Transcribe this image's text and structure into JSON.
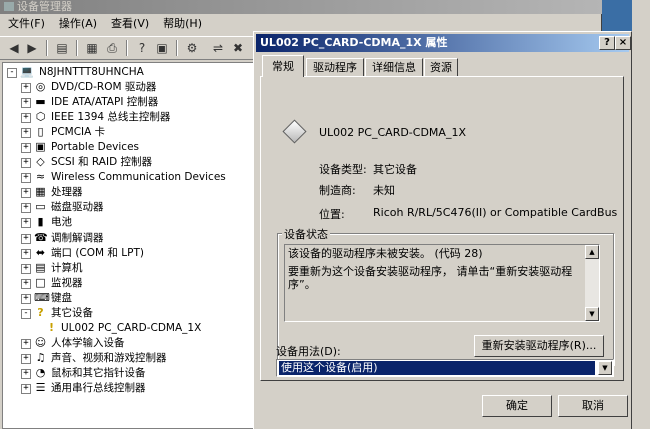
{
  "main_window": {
    "title": "设备管理器",
    "menu": [
      "文件(F)",
      "操作(A)",
      "查看(V)",
      "帮助(H)"
    ],
    "toolbar_icons": [
      "back-arrow-icon",
      "forward-arrow-icon",
      "tree-view-icon",
      "properties-icon",
      "print-icon",
      "help-icon",
      "refresh-icon",
      "scan-hardware-icon",
      "update-driver-icon",
      "uninstall-icon"
    ]
  },
  "tree": {
    "root": "N8JHNTTT8UHNCHA",
    "items": [
      {
        "label": "DVD/CD-ROM 驱动器",
        "icon": "cdrom-icon",
        "expander": "+"
      },
      {
        "label": "IDE ATA/ATAPI 控制器",
        "icon": "ide-icon",
        "expander": "+"
      },
      {
        "label": "IEEE 1394 总线主控制器",
        "icon": "ieee1394-icon",
        "expander": "+"
      },
      {
        "label": "PCMCIA 卡",
        "icon": "pcmcia-icon",
        "expander": "+"
      },
      {
        "label": "Portable Devices",
        "icon": "portable-device-icon",
        "expander": "+"
      },
      {
        "label": "SCSI 和 RAID 控制器",
        "icon": "scsi-icon",
        "expander": "+"
      },
      {
        "label": "Wireless Communication Devices",
        "icon": "wireless-icon",
        "expander": "+"
      },
      {
        "label": "处理器",
        "icon": "processor-icon",
        "expander": "+"
      },
      {
        "label": "磁盘驱动器",
        "icon": "disk-icon",
        "expander": "+"
      },
      {
        "label": "电池",
        "icon": "battery-icon",
        "expander": "+"
      },
      {
        "label": "调制解调器",
        "icon": "modem-icon",
        "expander": "+"
      },
      {
        "label": "端口 (COM 和 LPT)",
        "icon": "port-icon",
        "expander": "+"
      },
      {
        "label": "计算机",
        "icon": "computer-icon",
        "expander": "+"
      },
      {
        "label": "监视器",
        "icon": "monitor-icon",
        "expander": "+"
      },
      {
        "label": "键盘",
        "icon": "keyboard-icon",
        "expander": "+"
      },
      {
        "label": "其它设备",
        "icon": "unknown-device-icon",
        "expander": "-"
      },
      {
        "label": "UL002 PC_CARD-CDMA_1X",
        "icon": "warning-device-icon",
        "expander": "",
        "child": true
      },
      {
        "label": "人体学输入设备",
        "icon": "hid-icon",
        "expander": "+"
      },
      {
        "label": "声音、视频和游戏控制器",
        "icon": "sound-icon",
        "expander": "+"
      },
      {
        "label": "鼠标和其它指针设备",
        "icon": "mouse-icon",
        "expander": "+"
      },
      {
        "label": "通用串行总线控制器",
        "icon": "usb-icon",
        "expander": "+"
      }
    ]
  },
  "dialog": {
    "title": "UL002 PC_CARD-CDMA_1X 属性",
    "help_button": "?",
    "close_button": "×",
    "tabs": [
      "常规",
      "驱动程序",
      "详细信息",
      "资源"
    ],
    "device_name": "UL002 PC_CARD-CDMA_1X",
    "device_type_label": "设备类型:",
    "device_type_value": "其它设备",
    "manufacturer_label": "制造商:",
    "manufacturer_value": "未知",
    "location_label": "位置:",
    "location_value": "Ricoh R/RL/5C476(II) or Compatible CardBus",
    "status_group": "设备状态",
    "status_line1": "该设备的驱动程序未被安装。 (代码 28)",
    "status_line2": "要重新为这个设备安装驱动程序， 请单击“重新安装驱动程序”。",
    "reinstall_button": "重新安装驱动程序(R)...",
    "usage_label": "设备用法(D):",
    "usage_value": "使用这个设备(启用)",
    "ok_button": "确定",
    "cancel_button": "取消"
  }
}
